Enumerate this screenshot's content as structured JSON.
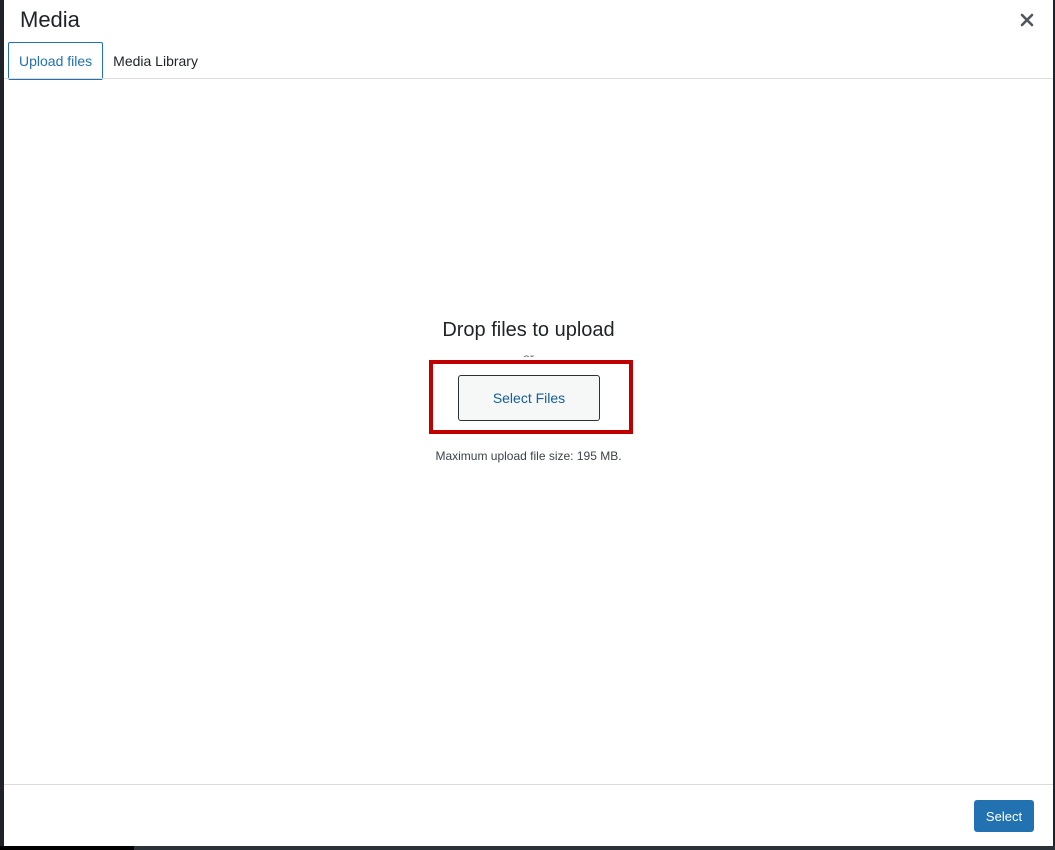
{
  "modal": {
    "title": "Media",
    "close_icon": "close-icon"
  },
  "tabs": [
    {
      "label": "Upload files",
      "active": true
    },
    {
      "label": "Media Library",
      "active": false
    }
  ],
  "upload": {
    "drop_title": "Drop files to upload",
    "or_text": "or",
    "select_files_label": "Select Files",
    "max_size_text": "Maximum upload file size: 195 MB."
  },
  "footer": {
    "select_label": "Select"
  },
  "colors": {
    "accent": "#2271b1",
    "highlight": "#c00000"
  }
}
